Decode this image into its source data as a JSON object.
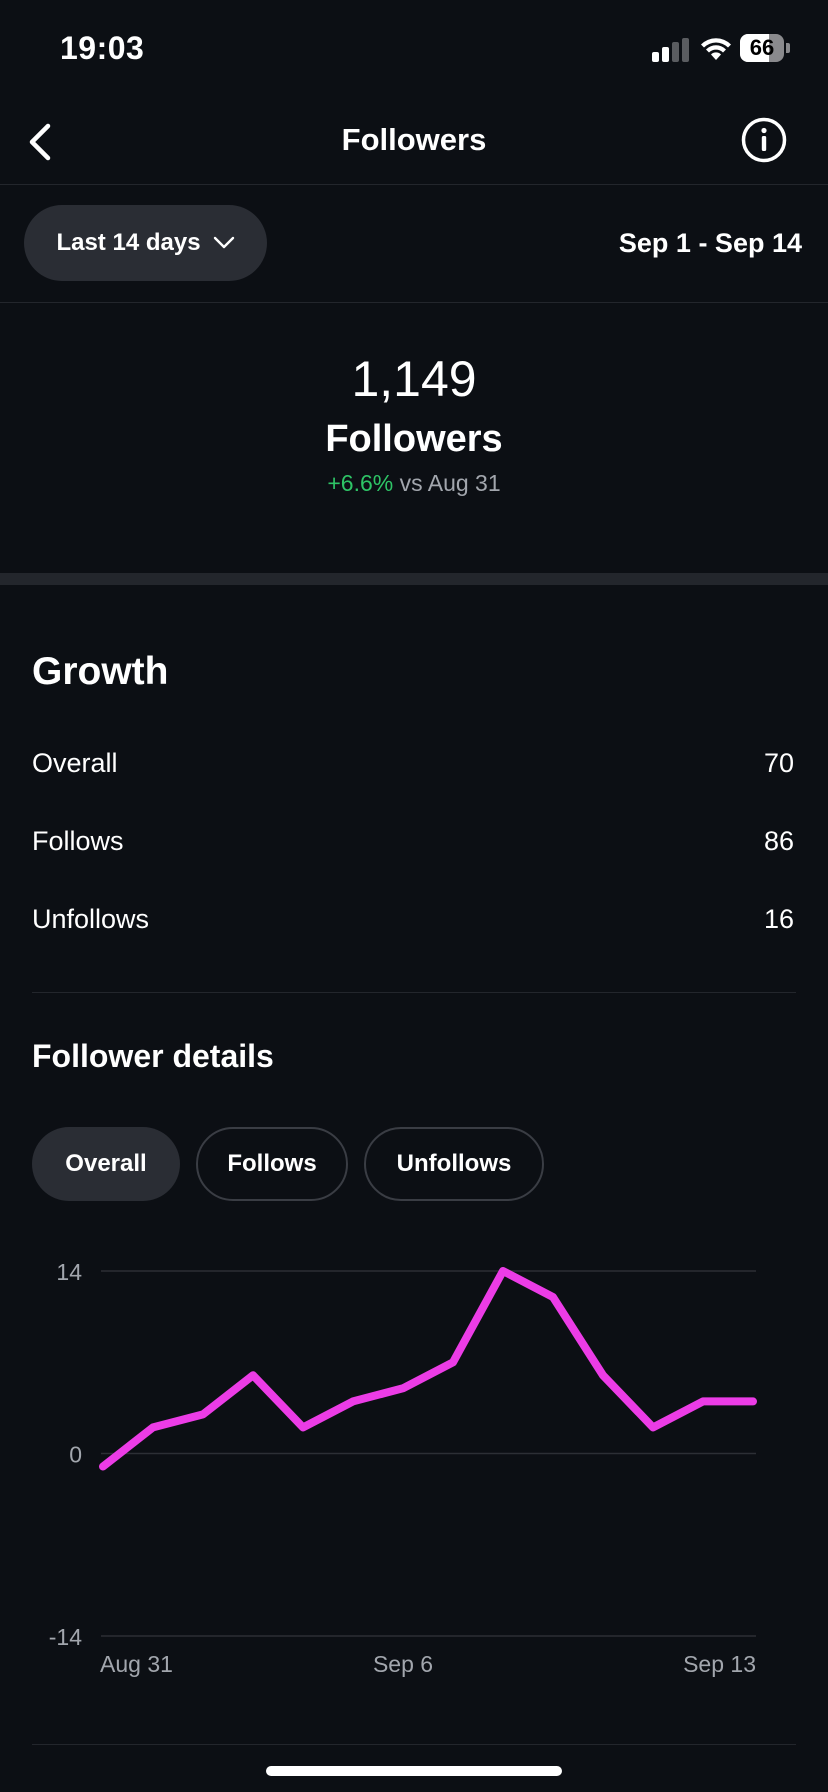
{
  "status_bar": {
    "time": "19:03",
    "battery": "66"
  },
  "nav": {
    "title": "Followers"
  },
  "filter": {
    "range_label": "Last 14 days",
    "date_range": "Sep 1 - Sep 14"
  },
  "summary": {
    "count": "1,149",
    "label": "Followers",
    "change": "+6.6%",
    "compare": "vs Aug 31",
    "positive_color": "#2ec466"
  },
  "growth": {
    "title": "Growth",
    "rows": [
      {
        "label": "Overall",
        "value": "70"
      },
      {
        "label": "Follows",
        "value": "86"
      },
      {
        "label": "Unfollows",
        "value": "16"
      }
    ]
  },
  "details": {
    "title": "Follower details",
    "tabs": [
      {
        "label": "Overall",
        "active": true
      },
      {
        "label": "Follows",
        "active": false
      },
      {
        "label": "Unfollows",
        "active": false
      }
    ]
  },
  "chart_data": {
    "type": "line",
    "x": [
      "Aug 31",
      "Sep 1",
      "Sep 2",
      "Sep 3",
      "Sep 4",
      "Sep 5",
      "Sep 6",
      "Sep 7",
      "Sep 8",
      "Sep 9",
      "Sep 10",
      "Sep 11",
      "Sep 12",
      "Sep 13"
    ],
    "x_tick_labels": [
      "Aug 31",
      "Sep 6",
      "Sep 13"
    ],
    "y_tick_labels": [
      "14",
      "0",
      "-14"
    ],
    "series": [
      {
        "values": [
          -1,
          2,
          3,
          6,
          2,
          4,
          5,
          7,
          14,
          12,
          6,
          2,
          4,
          4
        ],
        "color": "#ec3ce6"
      }
    ],
    "ylim": [
      -14,
      14
    ],
    "grid": true,
    "gridline_color": "#2c2f35"
  }
}
